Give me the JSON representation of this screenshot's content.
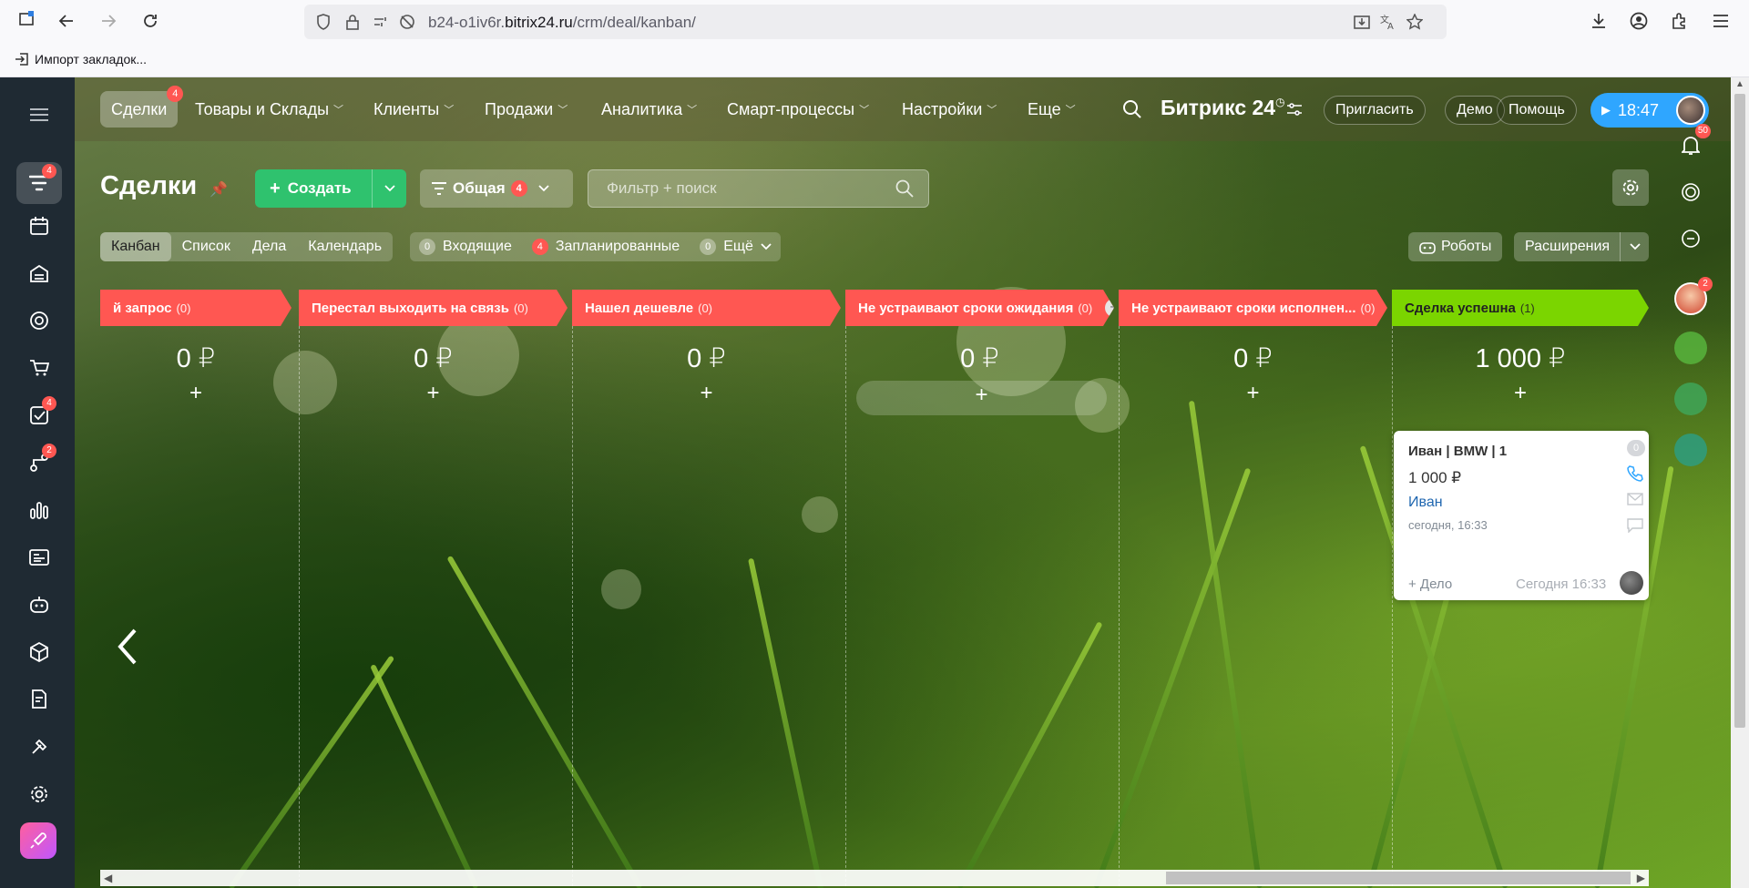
{
  "browser": {
    "url_prefix": "b24-o1iv6r.",
    "url_domain": "bitrix24.ru",
    "url_path": "/crm/deal/kanban/",
    "bookmark_label": "Импорт закладок..."
  },
  "nav": {
    "items": [
      {
        "label": "Сделки",
        "badge": "4"
      },
      {
        "label": "Товары и Склады"
      },
      {
        "label": "Клиенты"
      },
      {
        "label": "Продажи"
      },
      {
        "label": "Аналитика"
      },
      {
        "label": "Смарт-процессы"
      },
      {
        "label": "Настройки"
      },
      {
        "label": "Еще"
      }
    ],
    "logo": "Битрикс 24",
    "invite": "Пригласить",
    "demo": "Демо",
    "help": "Помощь",
    "time": "18:47"
  },
  "left_rail": {
    "badges": {
      "deals": "4",
      "tasks": "4",
      "flows": "2"
    }
  },
  "right_rail": {
    "notifications_badge": "50",
    "chat_badge": "2"
  },
  "toolbar": {
    "title": "Сделки",
    "create_label": "Создать",
    "pipeline_label": "Общая",
    "pipeline_badge": "4",
    "search_placeholder": "Фильтр + поиск"
  },
  "view_tabs": [
    "Канбан",
    "Список",
    "Дела",
    "Календарь"
  ],
  "counters": [
    {
      "count": "0",
      "label": "Входящие"
    },
    {
      "count": "4",
      "label": "Запланированные"
    },
    {
      "count": "0",
      "label": "Ещё"
    }
  ],
  "robots_label": "Роботы",
  "extensions_label": "Расширения",
  "stages": [
    {
      "title": "й запрос",
      "count": "(0)",
      "sum": "0 ₽",
      "color": "#ff5752"
    },
    {
      "title": "Перестал выходить на связь",
      "count": "(0)",
      "sum": "0 ₽",
      "color": "#ff5752"
    },
    {
      "title": "Нашел дешевле",
      "count": "(0)",
      "sum": "0 ₽",
      "color": "#ff5752"
    },
    {
      "title": "Не устраивают сроки ожидания",
      "count": "(0)",
      "sum": "0 ₽",
      "color": "#ff5752"
    },
    {
      "title": "Не устраивают сроки исполнен...",
      "count": "(0)",
      "sum": "0 ₽",
      "color": "#ff5752"
    },
    {
      "title": "Сделка успешна",
      "count": "(1)",
      "sum": "1 000 ₽",
      "color": "#7bd500"
    }
  ],
  "card": {
    "title": "Иван | BMW | 1",
    "price": "1 000 ₽",
    "client": "Иван",
    "date": "сегодня, 16:33",
    "add_activity": "+ Дело",
    "footer_date": "Сегодня 16:33",
    "counter": "0"
  }
}
